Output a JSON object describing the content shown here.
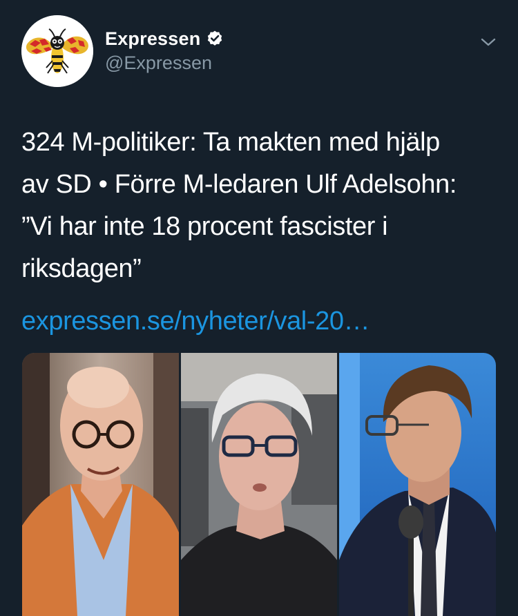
{
  "account": {
    "display_name": "Expressen",
    "handle": "@Expressen",
    "verified": true,
    "avatar_icon": "expressen-wasp-logo"
  },
  "icons": {
    "verified": "verified-badge-icon",
    "menu": "chevron-down-icon"
  },
  "tweet": {
    "text": "324 M-politiker: Ta makten med hjälp\nav SD • Förre M-ledaren Ulf Adelsohn:\n”Vi har inte 18 procent fascister i\nriksdagen”",
    "link_text": "expressen.se/nyheter/val-20…"
  },
  "colors": {
    "background": "#15202b",
    "text": "#ffffff",
    "secondary_text": "#8899a6",
    "link": "#1b95e0"
  }
}
